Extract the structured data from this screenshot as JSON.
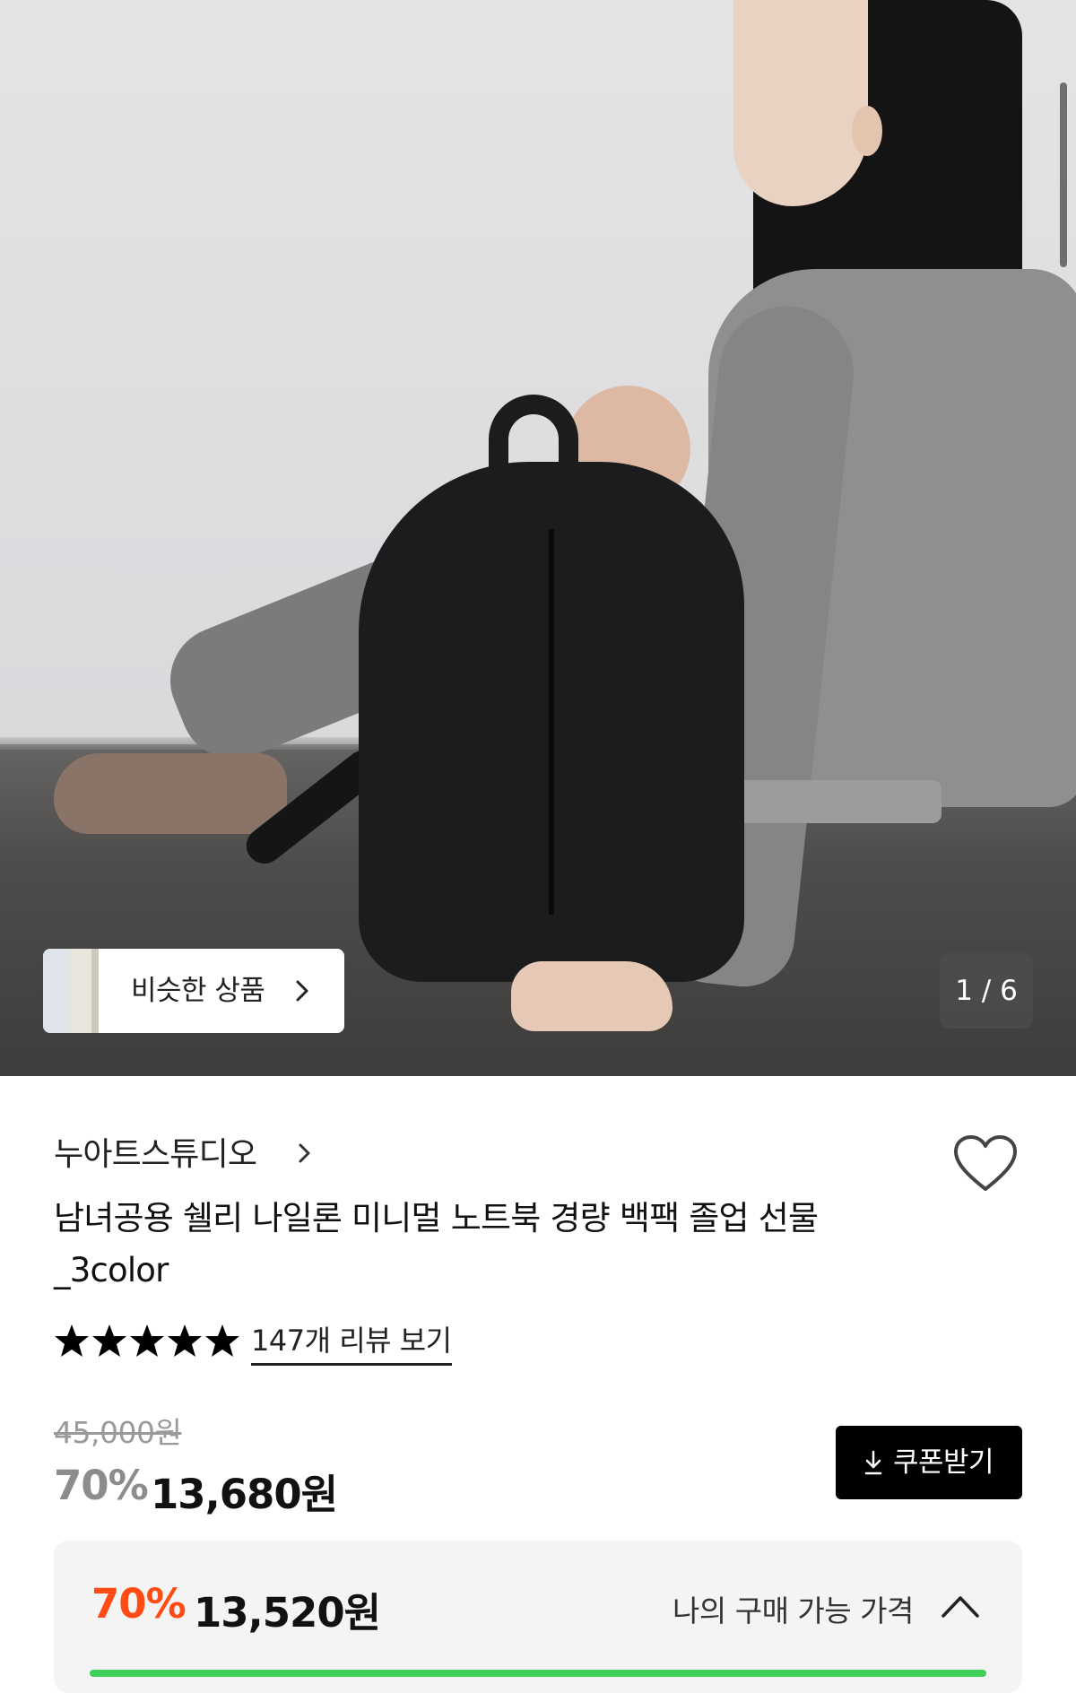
{
  "gallery": {
    "similar_label": "비슷한 상품",
    "counter": "1 / 6"
  },
  "product": {
    "brand": "누아트스튜디오",
    "title": "남녀공용 쉘리 나일론 미니멀 노트북 경량 백팩 졸업 선물 _3color",
    "rating_stars": 5,
    "reviews_label": "147개 리뷰 보기",
    "original_price": "45,000원",
    "discount": "70%",
    "price": "13,680원",
    "coupon_label": "쿠폰받기"
  },
  "my_price": {
    "discount": "70%",
    "price": "13,520원",
    "label": "나의 구매 가능 가격"
  },
  "colors": {
    "accent": "#ff4b14",
    "button": "#000000",
    "progress": "#3ed05a"
  }
}
